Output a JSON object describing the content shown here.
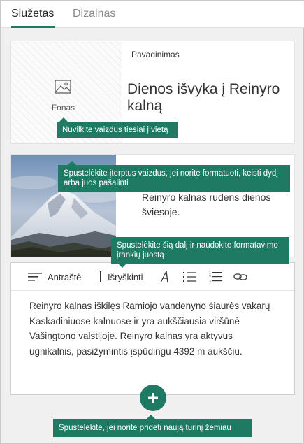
{
  "tabs": [
    {
      "label": "Siužetas",
      "active": true
    },
    {
      "label": "Dizainas",
      "active": false
    }
  ],
  "title_card": {
    "background_label": "Fonas",
    "title_label": "Pavadinimas",
    "title_text": "Dienos išvyka į Reinyro kalną"
  },
  "image_card": {
    "caption": "Reinyro kalnas rudens dienos šviesoje."
  },
  "text_card": {
    "toolbar": {
      "heading_label": "Antraštė",
      "emphasis_label": "Išryškinti"
    },
    "body": "Reinyro kalnas iškilęs Ramiojo vandenyno šiaurės vakarų Kaskadiniuose kalnuose ir yra aukščiausia viršūnė Vašingtono valstijoje. Reinyro kalnas yra aktyvus ugnikalnis, pasižymintis įspūdingu 4392 m aukščiu."
  },
  "tooltips": {
    "drag_images": "Nuvilkite vaizdus tiesiai į vietą",
    "click_image": "Spustelėkite įterptus vaizdus, jei norite formatuoti, keisti dydį arba juos pašalinti",
    "click_text": "Spustelėkite šią dalį ir naudokite formatavimo įrankių juostą",
    "add_content": "Spustelėkite, jei norite pridėti naują turinį žemiau"
  },
  "colors": {
    "accent": "#1f7a63"
  },
  "icons": [
    "image-icon",
    "heading-icon",
    "emphasis-bar-icon",
    "italic-a-icon",
    "bullet-list-icon",
    "numbered-list-icon",
    "link-icon",
    "plus-icon"
  ]
}
